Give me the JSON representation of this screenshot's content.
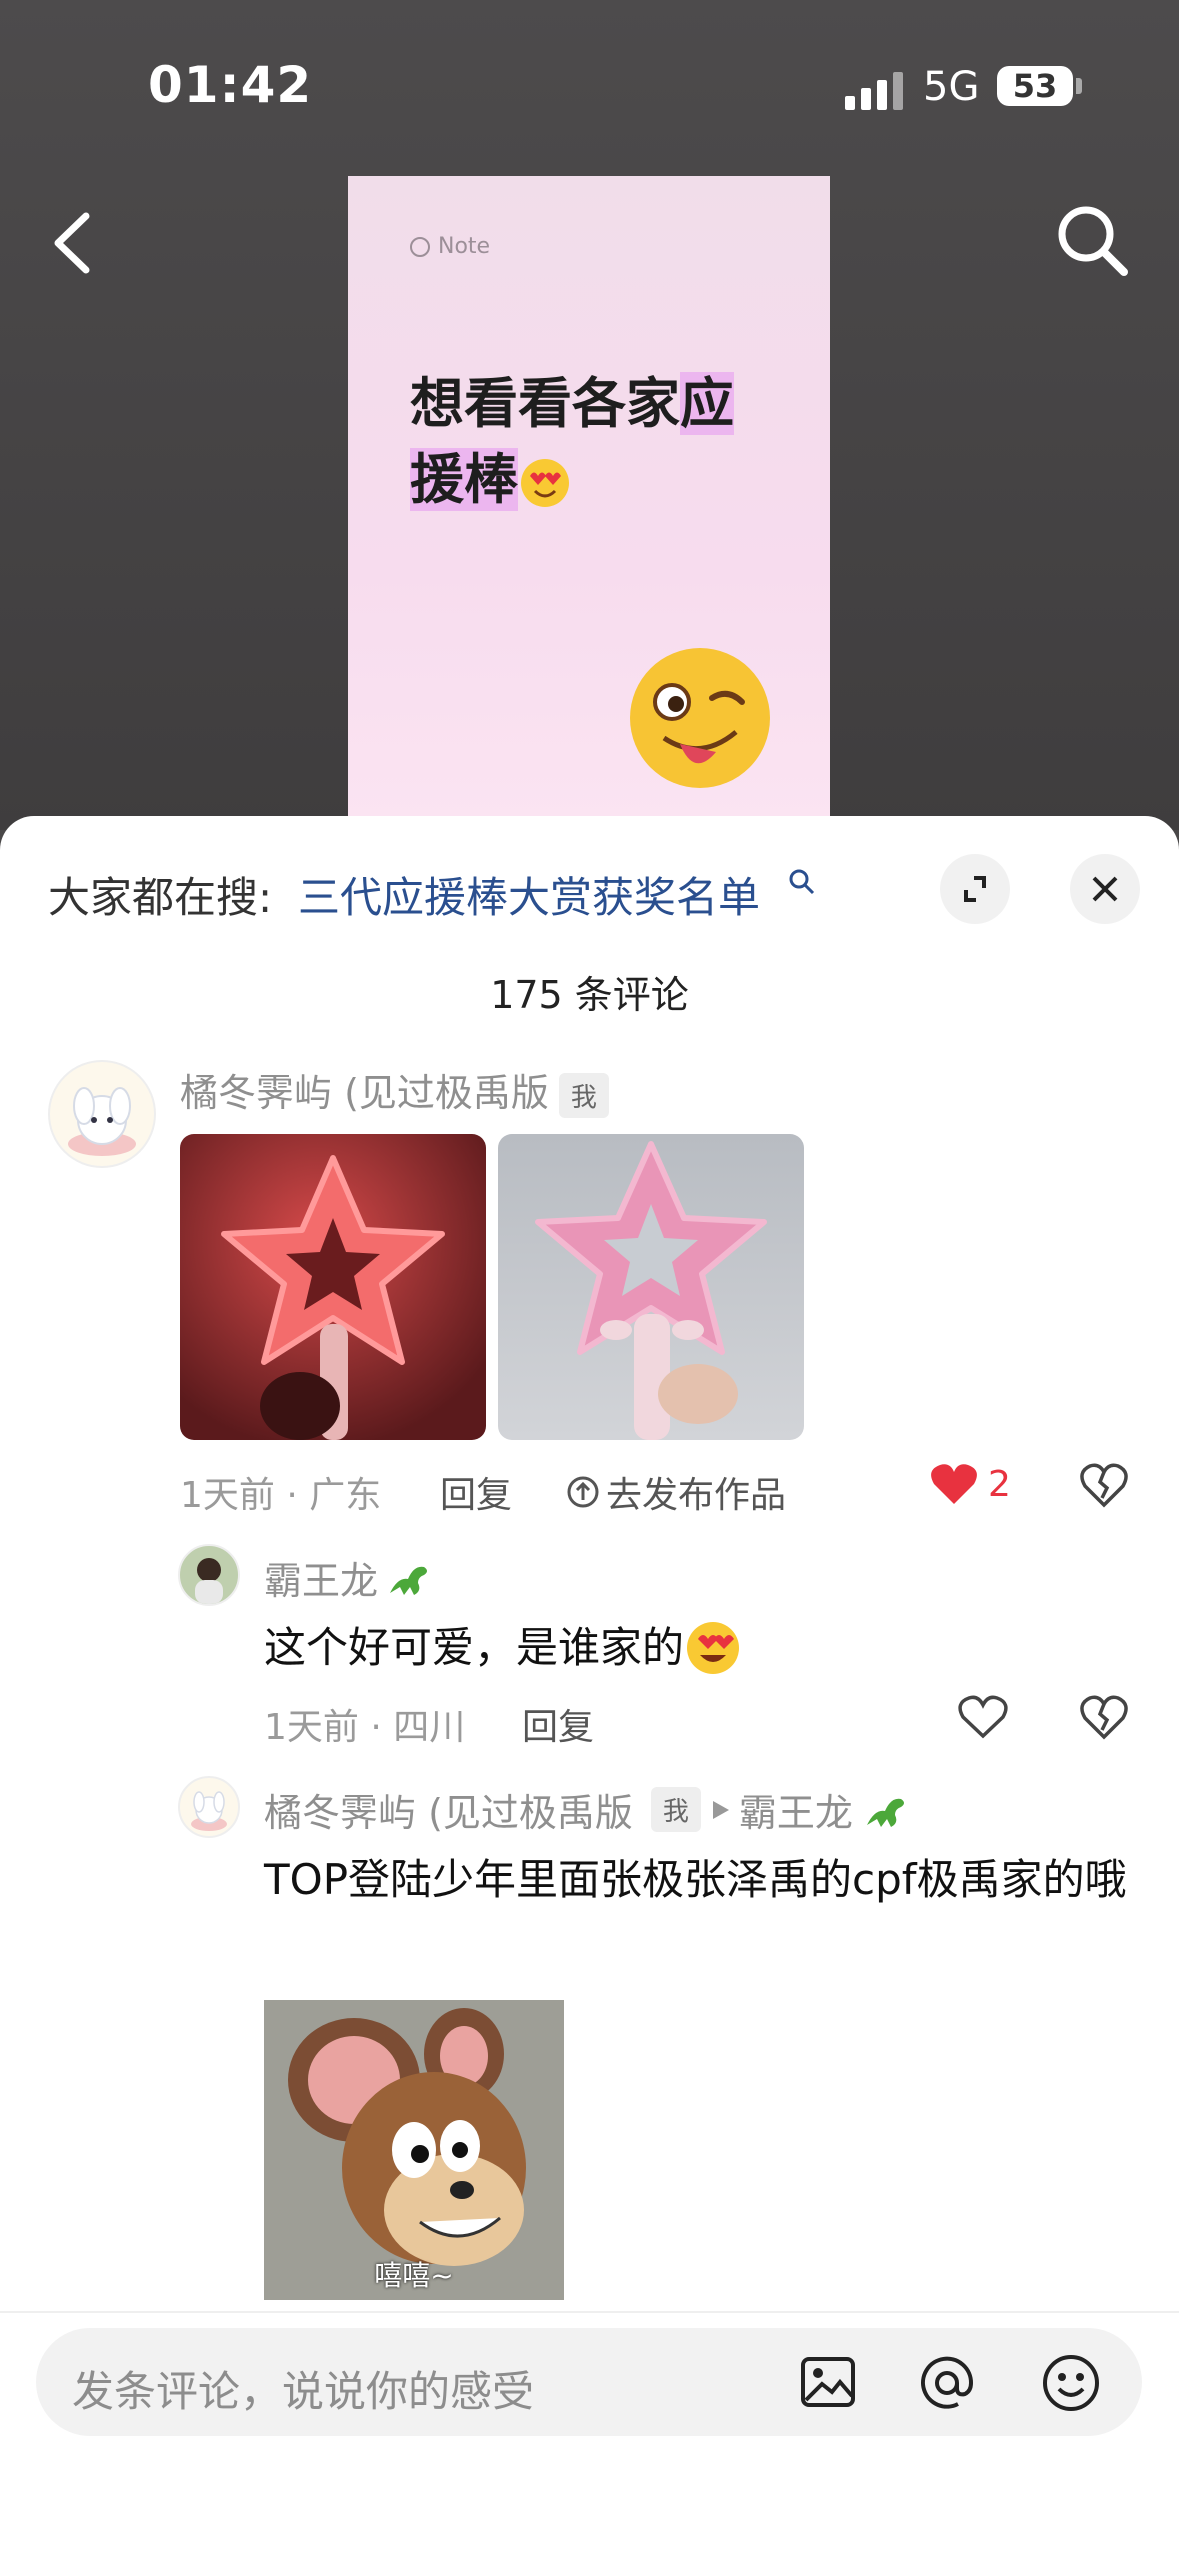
{
  "status_bar": {
    "time": "01:42",
    "network": "5G",
    "battery": "53"
  },
  "note": {
    "label": "Note",
    "title_part1": "想看看各家",
    "title_highlight_1": "应",
    "title_highlight_2": "援棒"
  },
  "sheet": {
    "search_prefix": "大家都在搜:",
    "search_link": "三代应援棒大赏获奖名单",
    "comment_count": "175 条评论"
  },
  "comments": [
    {
      "username": "橘冬霁屿 (见过极禹版",
      "badge": "我",
      "meta": "1天前 · 广东",
      "reply_label": "回复",
      "publish_label": "去发布作品",
      "like_count": "2"
    },
    {
      "username": "霸王龙",
      "text": "这个好可爱，是谁家的",
      "meta": "1天前 · 四川",
      "reply_label": "回复"
    },
    {
      "username": "橘冬霁屿 (见过极禹版",
      "badge": "我",
      "reply_to": "霸王龙",
      "text": "TOP登陆少年里面张极张泽禹的cpf极禹家的哦",
      "meme_caption": "嘻嘻~"
    }
  ],
  "input": {
    "placeholder": "发条评论，说说你的感受"
  },
  "colors": {
    "link": "#2a4f8f",
    "like_active": "#e8323f",
    "highlight": "#ecb6ef"
  }
}
